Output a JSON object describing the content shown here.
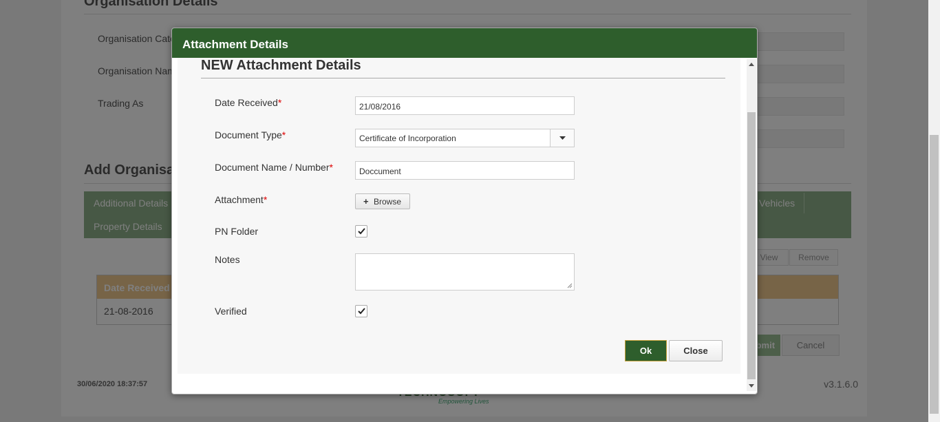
{
  "background": {
    "section_title": "Organisation Details",
    "fields": [
      "Organisation Category",
      "Organisation Name",
      "Trading As"
    ],
    "add_section_title": "Add Organisation",
    "tabs": [
      "Additional Details",
      "Vehicles",
      "Property Details"
    ],
    "mini_buttons": [
      "View",
      "Remove"
    ],
    "grid_header": "Date Received",
    "grid_cell": "21-08-2016",
    "submit_label": "Submit",
    "cancel_label": "Cancel",
    "footer_timestamp": "30/06/2020 18:37:57",
    "footer_version": "v3.1.6.0",
    "footer_logo": "TECHNOSOFT",
    "footer_tagline": "Empowering Lives"
  },
  "dialog": {
    "title": "Attachment Details",
    "form_title": "NEW Attachment Details",
    "required_marker": "*",
    "date_received": {
      "label": "Date Received",
      "value": "21/08/2016"
    },
    "document_type": {
      "label": "Document Type",
      "value": "Certificate of Incorporation"
    },
    "document_name": {
      "label": "Document Name / Number",
      "value": "Doccument"
    },
    "attachment": {
      "label": "Attachment",
      "button": "Browse",
      "button_icon": "+"
    },
    "pn_folder": {
      "label": "PN Folder",
      "checked": true
    },
    "notes": {
      "label": "Notes",
      "value": ""
    },
    "verified": {
      "label": "Verified",
      "checked": true
    },
    "ok_label": "Ok",
    "close_label": "Close"
  }
}
